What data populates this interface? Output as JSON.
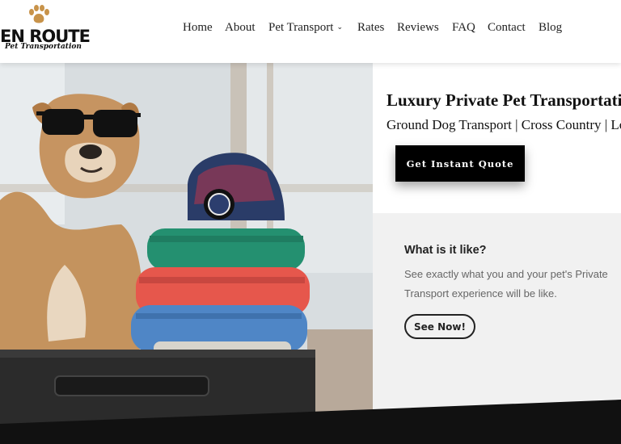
{
  "header": {
    "logo": {
      "brand": "EN ROUTE",
      "tagline": "Pet Transportation"
    },
    "nav": [
      {
        "label": "Home"
      },
      {
        "label": "About"
      },
      {
        "label": "Pet Transport",
        "has_dropdown": true,
        "icon": "chevron-down-icon"
      },
      {
        "label": "Rates"
      },
      {
        "label": "Reviews"
      },
      {
        "label": "FAQ"
      },
      {
        "label": "Contact"
      },
      {
        "label": "Blog"
      }
    ]
  },
  "hero": {
    "title": "Luxury Private Pet Transportation",
    "subtitle": "Ground Dog Transport | Cross Country | Local",
    "quote_button": "Get Instant Quote"
  },
  "info": {
    "heading": "What is it like?",
    "text": "See exactly what you and your pet's Private Transport experience will be like.",
    "button": "See Now!"
  },
  "colors": {
    "accent_paw": "#c8934a",
    "button_bg": "#000000",
    "panel_bg": "#f1f1f1",
    "band": "#111111"
  }
}
